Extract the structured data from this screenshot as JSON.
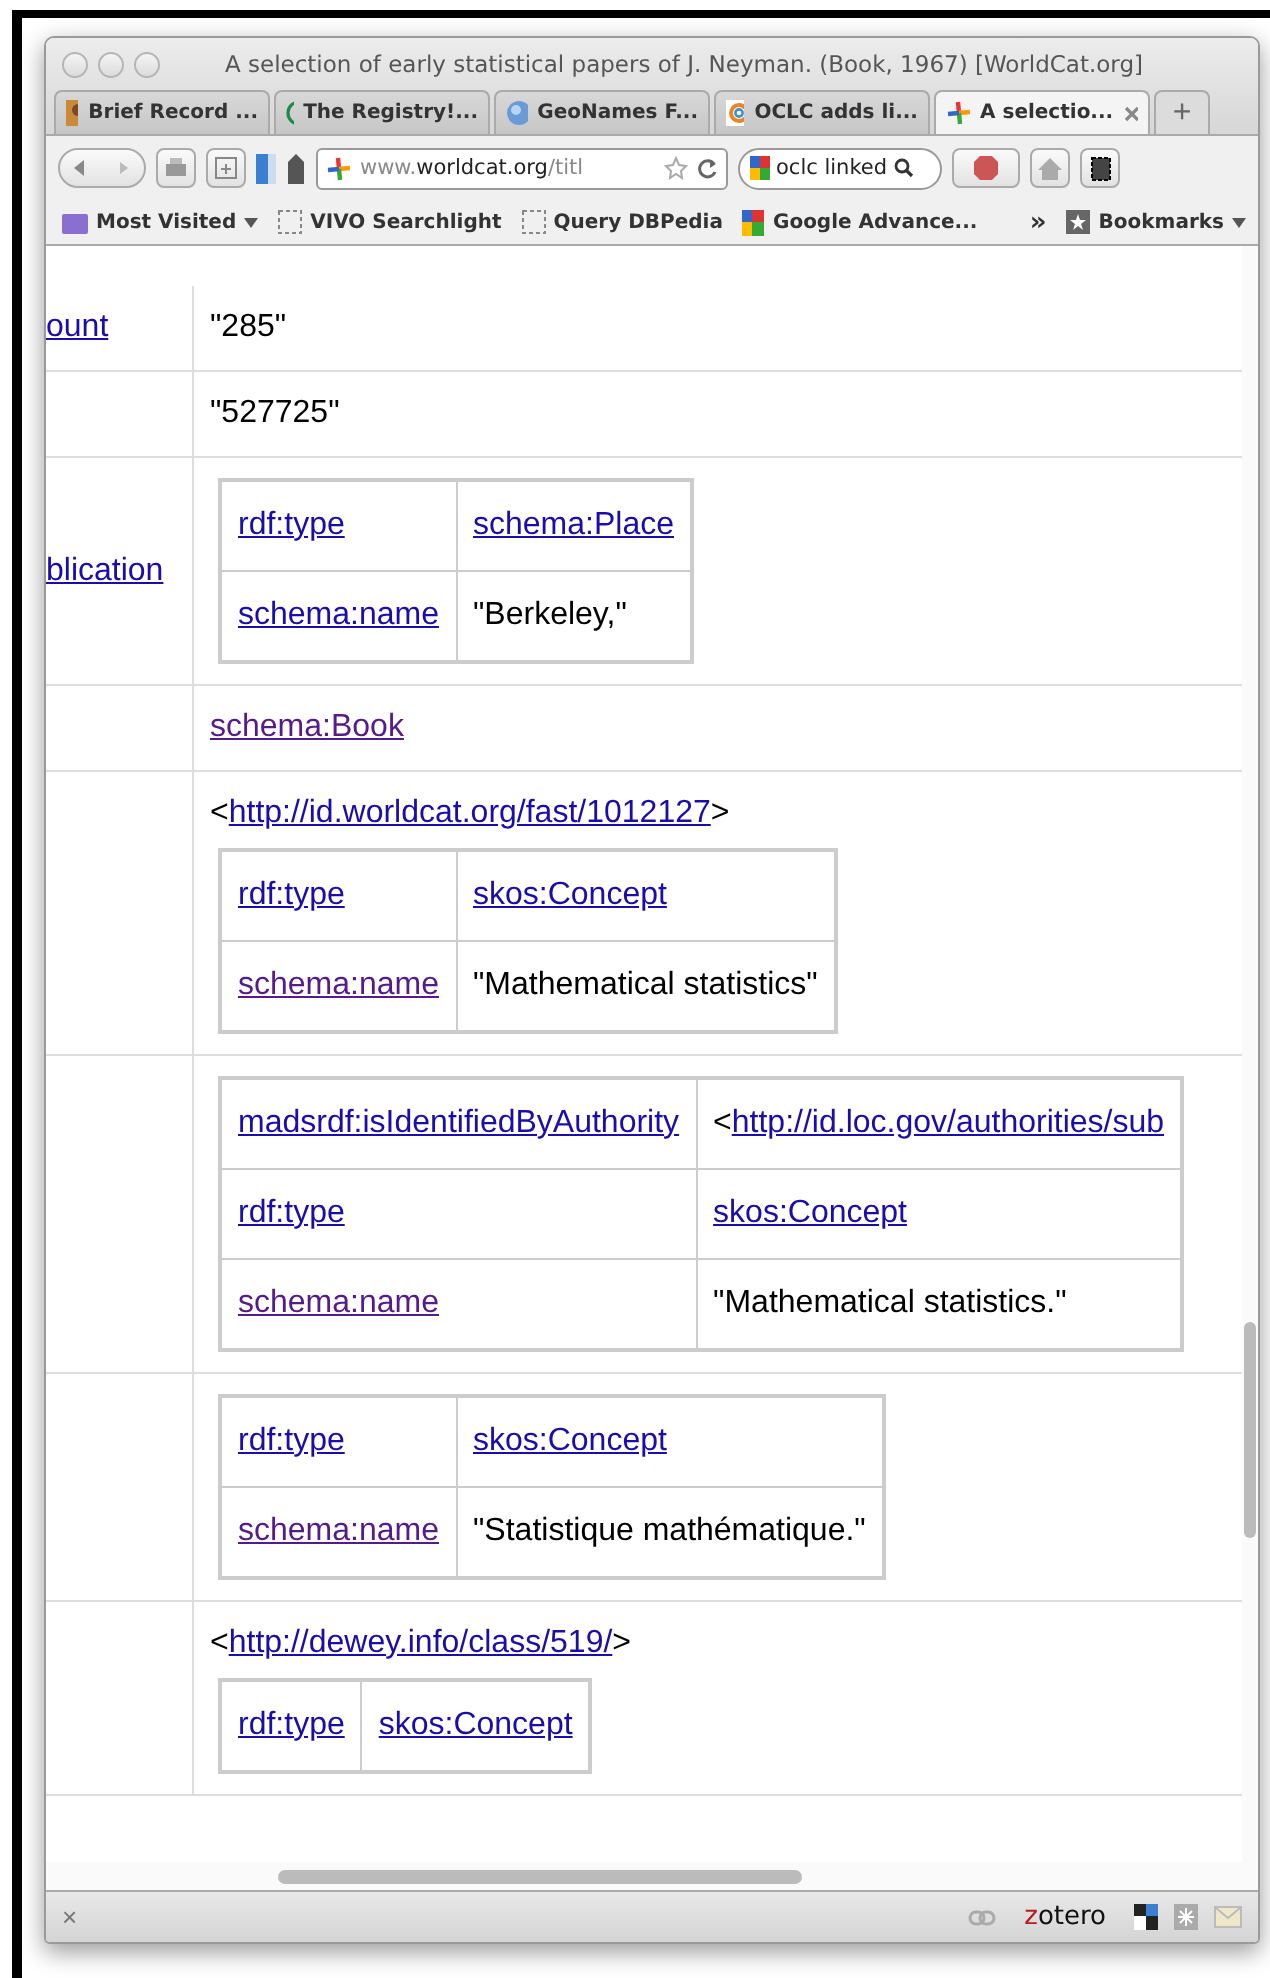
{
  "window": {
    "title": "A selection of early statistical papers of J. Neyman. (Book, 1967) [WorldCat.org]"
  },
  "tabs": [
    {
      "label": "Brief Record ...",
      "selected": false
    },
    {
      "label": "The Registry!...",
      "selected": false
    },
    {
      "label": "GeoNames F...",
      "selected": false
    },
    {
      "label": "OCLC adds li...",
      "selected": false
    },
    {
      "label": "A selectio...",
      "selected": true
    }
  ],
  "new_tab": "+",
  "toolbar": {
    "url": "www.**worldcat.org**/titl",
    "search": "oclc linked"
  },
  "bookmarks": {
    "items": [
      {
        "label": "Most Visited",
        "kind": "menu"
      },
      {
        "label": "VIVO Searchlight",
        "kind": "bookmarklet"
      },
      {
        "label": "Query DBPedia",
        "kind": "bookmarklet"
      },
      {
        "label": "Google Advance...",
        "kind": "google"
      }
    ],
    "overflow": "»",
    "menu": "Bookmarks"
  },
  "rows": [
    {
      "property": "ount",
      "values": [
        {
          "kind": "literal",
          "text": "\"285\""
        }
      ]
    },
    {
      "values": [
        {
          "kind": "literal",
          "text": "\"527725\""
        }
      ]
    },
    {
      "property": "blication",
      "values": [
        {
          "kind": "table",
          "rows": [
            [
              {
                "kind": "link",
                "text": "rdf:type",
                "visited": false
              },
              {
                "kind": "link",
                "text": "schema:Place",
                "visited": false
              }
            ],
            [
              {
                "kind": "link",
                "text": "schema:name",
                "visited": false
              },
              {
                "kind": "literal",
                "text": "\"Berkeley,\""
              }
            ]
          ]
        }
      ]
    },
    {
      "values": [
        {
          "kind": "link",
          "text": "schema:Book",
          "visited": true
        }
      ]
    },
    {
      "values": [
        {
          "kind": "uri",
          "open": "<",
          "url": "http://id.worldcat.org/fast/1012127",
          "close": ">"
        },
        {
          "kind": "table",
          "rows": [
            [
              {
                "kind": "link",
                "text": "rdf:type",
                "visited": false
              },
              {
                "kind": "link",
                "text": "skos:Concept",
                "visited": false
              }
            ],
            [
              {
                "kind": "link",
                "text": "schema:name",
                "visited": true
              },
              {
                "kind": "literal",
                "text": "\"Mathematical statistics\""
              }
            ]
          ]
        }
      ]
    },
    {
      "values": [
        {
          "kind": "table",
          "rows": [
            [
              {
                "kind": "link",
                "text": "madsrdf:isIdentifiedByAuthority",
                "visited": false
              },
              {
                "kind": "uri",
                "open": "<",
                "url": "http://id.loc.gov/authorities/sub"
              }
            ],
            [
              {
                "kind": "link",
                "text": "rdf:type",
                "visited": false
              },
              {
                "kind": "link",
                "text": "skos:Concept",
                "visited": false
              }
            ],
            [
              {
                "kind": "link",
                "text": "schema:name",
                "visited": true
              },
              {
                "kind": "literal",
                "text": "\"Mathematical statistics.\""
              }
            ]
          ]
        }
      ]
    },
    {
      "values": [
        {
          "kind": "table",
          "rows": [
            [
              {
                "kind": "link",
                "text": "rdf:type",
                "visited": false
              },
              {
                "kind": "link",
                "text": "skos:Concept",
                "visited": false
              }
            ],
            [
              {
                "kind": "link",
                "text": "schema:name",
                "visited": true
              },
              {
                "kind": "literal",
                "text": "\"Statistique mathématique.\""
              }
            ]
          ]
        }
      ]
    },
    {
      "values": [
        {
          "kind": "uri",
          "open": "<",
          "url": "http://dewey.info/class/519/",
          "close": ">"
        },
        {
          "kind": "table",
          "rows": [
            [
              {
                "kind": "link",
                "text": "rdf:type",
                "visited": false
              },
              {
                "kind": "link",
                "text": "skos:Concept",
                "visited": false
              }
            ]
          ]
        }
      ]
    }
  ],
  "status_bar": {
    "close": "×",
    "zotero": "zotero"
  }
}
